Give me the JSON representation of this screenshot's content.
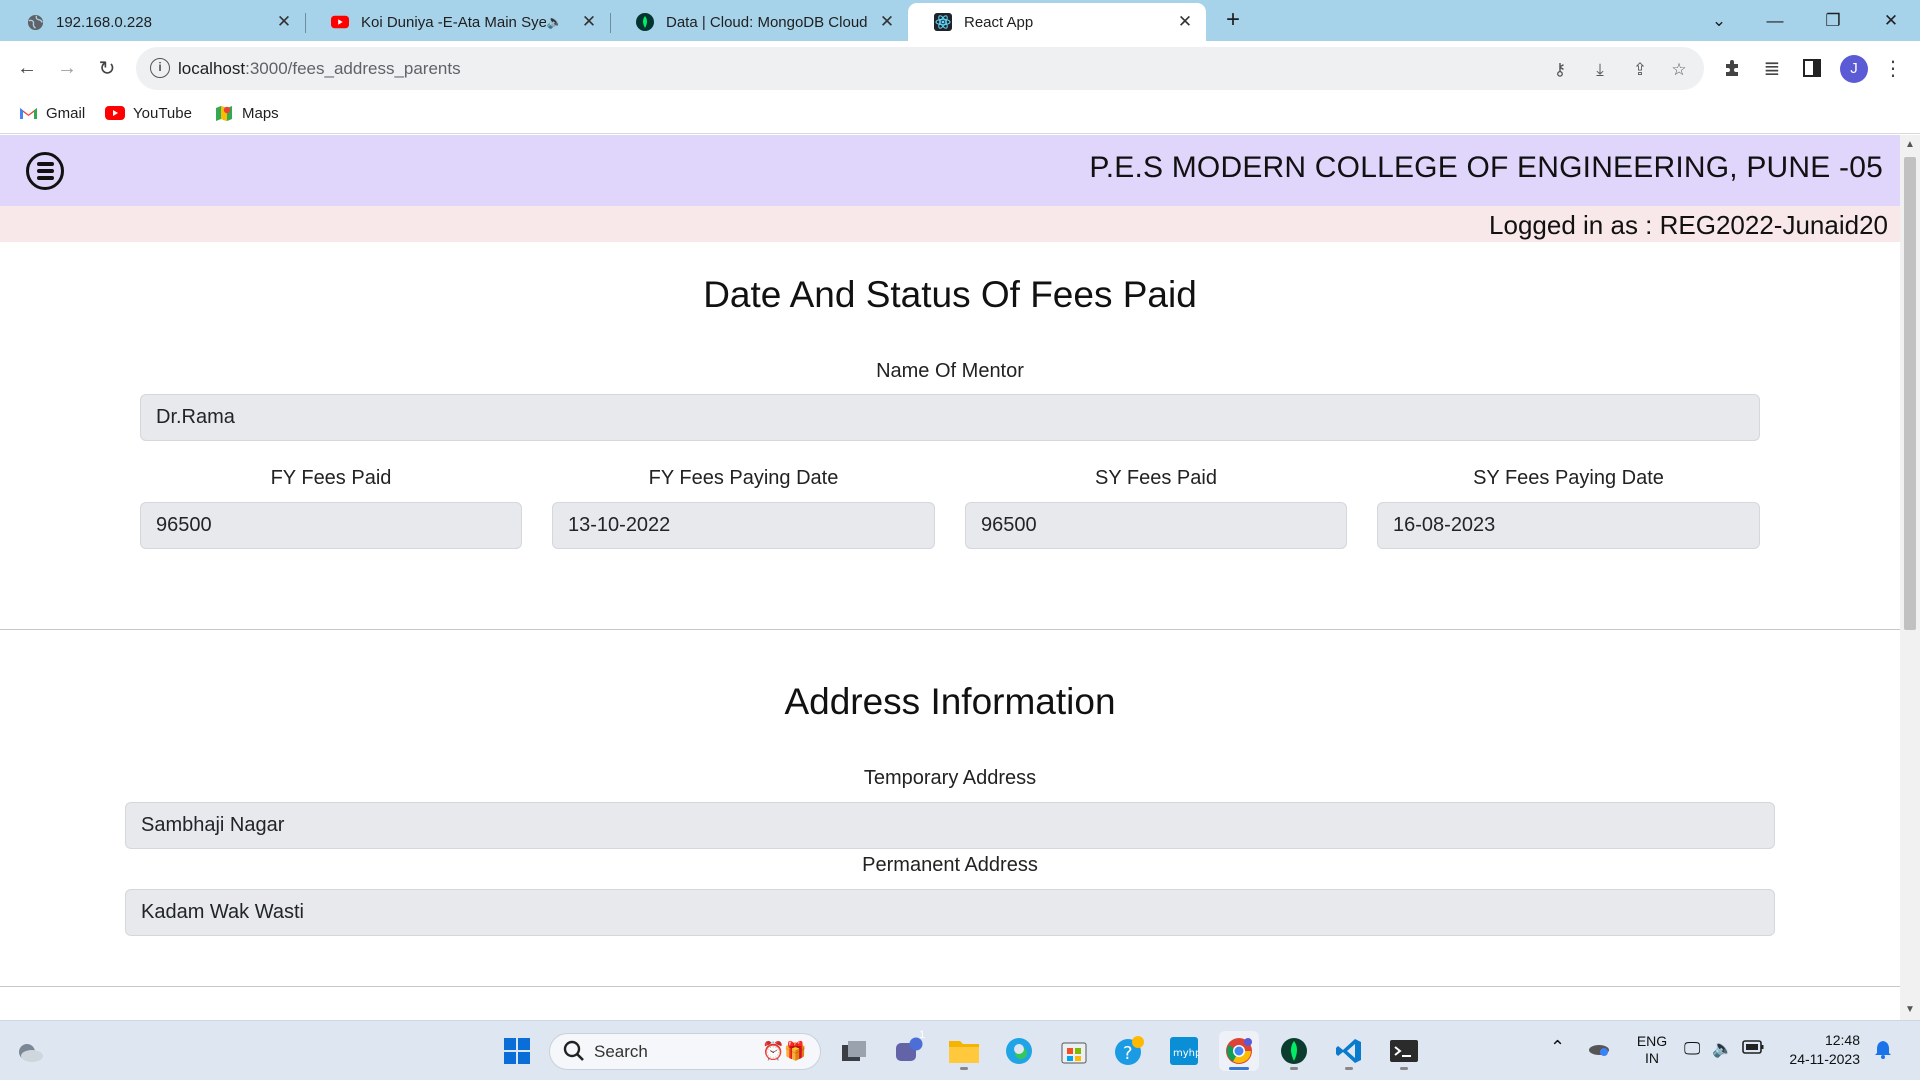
{
  "browser": {
    "tabs": [
      {
        "title": "192.168.0.228",
        "icon": "globe-icon"
      },
      {
        "title": "Koi Duniya -E-Ata Main Syed",
        "icon": "youtube-icon",
        "audio": true
      },
      {
        "title": "Data | Cloud: MongoDB Cloud",
        "icon": "mongodb-leaf-icon"
      },
      {
        "title": "React App",
        "icon": "react-icon",
        "active": true
      }
    ],
    "url_host": "localhost",
    "url_path": ":3000/fees_address_parents",
    "profile_initial": "J",
    "bookmarks": [
      {
        "label": "Gmail",
        "icon": "gmail-icon"
      },
      {
        "label": "YouTube",
        "icon": "youtube-icon"
      },
      {
        "label": "Maps",
        "icon": "maps-icon"
      }
    ]
  },
  "app": {
    "college_name": "P.E.S MODERN COLLEGE OF ENGINEERING, PUNE -05",
    "logged_in": "Logged in as : REG2022-Junaid20",
    "fees_section": {
      "title": "Date And Status Of Fees Paid",
      "mentor_label": "Name Of Mentor",
      "mentor_value": "Dr.Rama",
      "fy_paid_label": "FY Fees Paid",
      "fy_paid_value": "96500",
      "fy_date_label": "FY Fees Paying Date",
      "fy_date_value": "13-10-2022",
      "sy_paid_label": "SY Fees Paid",
      "sy_paid_value": "96500",
      "sy_date_label": "SY Fees Paying Date",
      "sy_date_value": "16-08-2023"
    },
    "address_section": {
      "title": "Address Information",
      "temp_label": "Temporary Address",
      "temp_value": "Sambhaji Nagar",
      "perm_label": "Permanent Address",
      "perm_value": "Kadam Wak Wasti"
    }
  },
  "taskbar": {
    "search_label": "Search",
    "lang_top": "ENG",
    "lang_bottom": "IN",
    "time": "12:48",
    "date": "24-11-2023",
    "teams_badge": "1"
  },
  "colors": {
    "tabstrip": "#a7d3ea",
    "navbar": "#e0d5fb",
    "loginbar": "#f9e8e9",
    "field_bg": "#e7e9ec",
    "taskbar": "#dde6f1"
  }
}
